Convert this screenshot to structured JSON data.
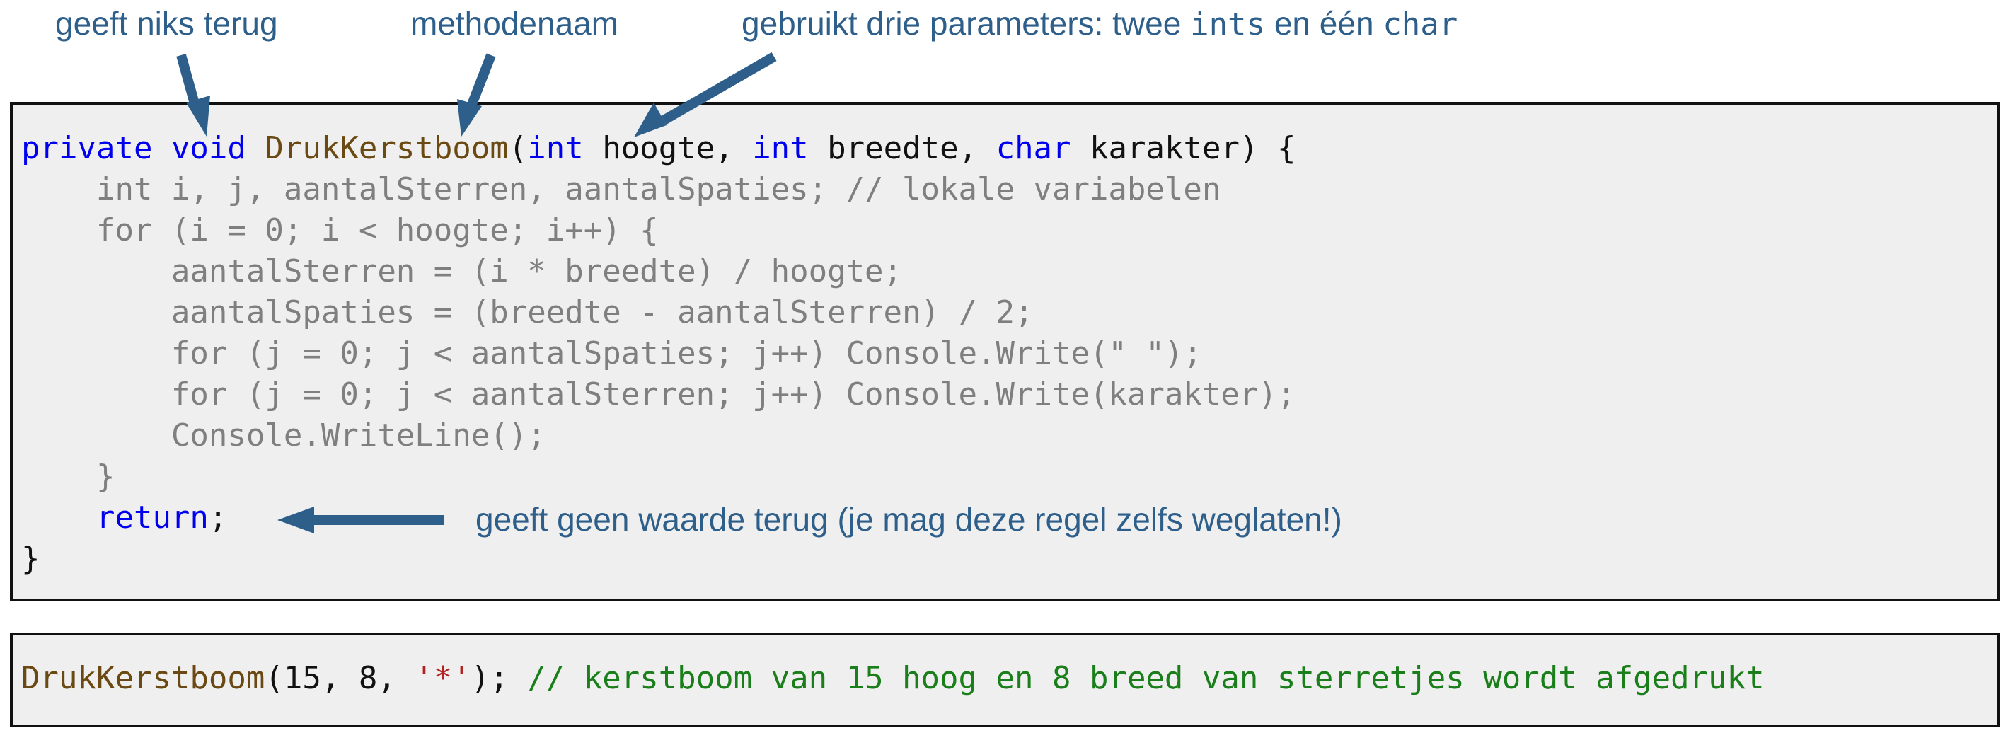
{
  "annotations": {
    "void_note": "geeft niks terug",
    "name_note": "methodenaam",
    "params_note": {
      "pre": "gebruikt drie parameters: twee ",
      "ints": "ints",
      "mid": " en één ",
      "char": "char"
    },
    "return_note": "geeft geen waarde terug (je mag deze regel zelfs weglaten!)"
  },
  "method_code": {
    "signature": {
      "private": "private",
      "void": "void",
      "name": "DrukKerstboom",
      "open": "(",
      "int1": "int",
      "p1": " hoogte, ",
      "int2": "int",
      "p2": " breedte, ",
      "char": "char",
      "p3": " karakter) {"
    },
    "body": [
      "    int i, j, aantalSterren, aantalSpaties; // lokale variabelen",
      "    for (i = 0; i < hoogte; i++) {",
      "        aantalSterren = (i * breedte) / hoogte;",
      "        aantalSpaties = (breedte - aantalSterren) / 2;",
      "        for (j = 0; j < aantalSpaties; j++) Console.Write(\" \");",
      "        for (j = 0; j < aantalSterren; j++) Console.Write(karakter);",
      "        Console.WriteLine();",
      "    }"
    ],
    "return_line": {
      "indent": "    ",
      "keyword": "return",
      "semi": ";"
    },
    "closing": "}"
  },
  "call_code": {
    "name": "DrukKerstboom",
    "args": "(15, 8, ",
    "char_literal": "'*'",
    "end": ");",
    "comment": " // kerstboom van 15 hoog en 8 breed van sterretjes wordt afgedrukt"
  },
  "colors": {
    "annotation": "#2e5f8a",
    "keyword": "#0000ee",
    "method_name": "#6a4a12",
    "body_text": "#7f7f7f",
    "string": "#b22222",
    "comment": "#1a7f1a",
    "code_background": "#efefef"
  }
}
